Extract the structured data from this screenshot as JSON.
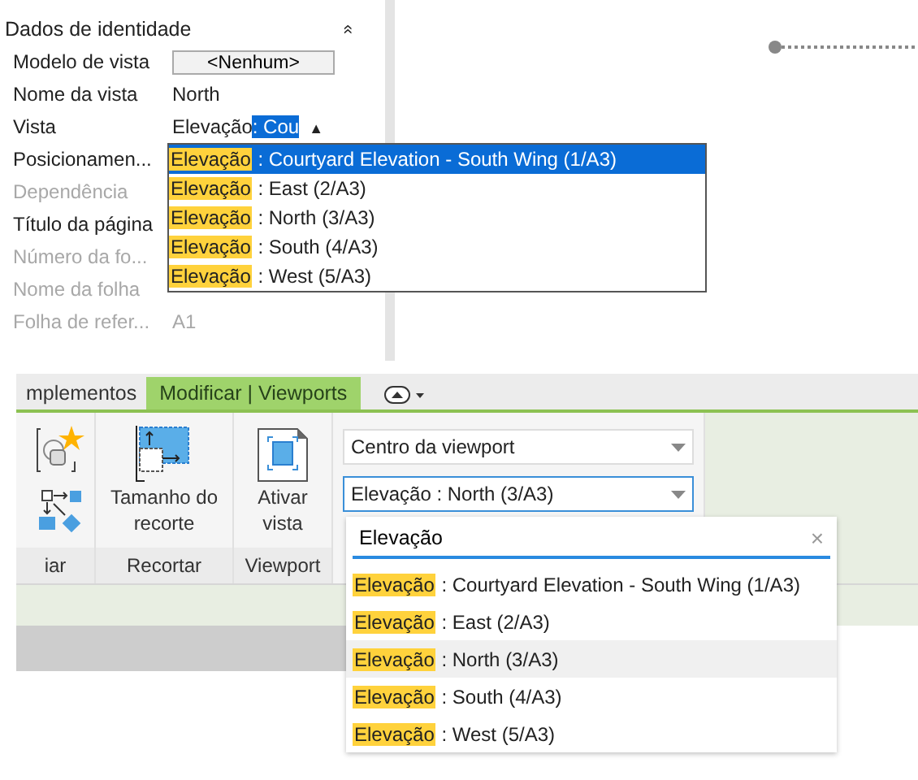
{
  "properties": {
    "header": "Dados de identidade",
    "collapse_icon": "»",
    "rows": [
      {
        "label": "Modelo de vista",
        "kind": "button",
        "value": "<Nenhum>",
        "disabled": false
      },
      {
        "label": "Nome da vista",
        "kind": "text",
        "value": "North",
        "disabled": false
      },
      {
        "label": "Vista",
        "kind": "combo",
        "value": "Elevação",
        "value_selected": ": Cou",
        "caret": "▲",
        "disabled": false
      },
      {
        "label": "Posicionamen...",
        "kind": "text",
        "disabled": false
      },
      {
        "label": "Dependência",
        "kind": "text",
        "disabled": true
      },
      {
        "label": "Título da página",
        "kind": "text",
        "disabled": false
      },
      {
        "label": "Número da fo...",
        "kind": "text",
        "disabled": true
      },
      {
        "label": "Nome da folha",
        "kind": "text",
        "disabled": true
      },
      {
        "label": "Folha de refer...",
        "kind": "text",
        "value": "A1",
        "disabled": true
      }
    ],
    "dropdown": [
      {
        "match": "Elevação",
        "rest": ": Courtyard Elevation - South Wing (1/A3)",
        "selected": true
      },
      {
        "match": "Elevação",
        "rest": ": East (2/A3)",
        "selected": false
      },
      {
        "match": "Elevação",
        "rest": ": North (3/A3)",
        "selected": false
      },
      {
        "match": "Elevação",
        "rest": ": South (4/A3)",
        "selected": false
      },
      {
        "match": "Elevação",
        "rest": ": West (5/A3)",
        "selected": false
      }
    ]
  },
  "ribbon": {
    "tabs": [
      {
        "label": "mplementos",
        "selected": false
      },
      {
        "label": "Modificar | Viewports",
        "selected": true
      }
    ],
    "panels": [
      {
        "label": "iar",
        "kind": "modify"
      },
      {
        "label": "Recortar",
        "kind": "crop",
        "button": "Tamanho do recorte"
      },
      {
        "label": "Viewport",
        "kind": "activate",
        "button": "Ativar vista"
      },
      {
        "kind": "combos",
        "combos": [
          {
            "value": "Centro da viewport",
            "focused": false
          },
          {
            "value": "Elevação : North (3/A3)",
            "focused": true
          }
        ]
      }
    ],
    "search": {
      "value": "Elevação",
      "clear": "×"
    },
    "results": [
      {
        "match": "Elevação",
        "rest": ": Courtyard Elevation - South Wing (1/A3)",
        "selected": false
      },
      {
        "match": "Elevação",
        "rest": ": East (2/A3)",
        "selected": false
      },
      {
        "match": "Elevação",
        "rest": ": North (3/A3)",
        "selected": true
      },
      {
        "match": "Elevação",
        "rest": ": South (4/A3)",
        "selected": false
      },
      {
        "match": "Elevação",
        "rest": ": West (5/A3)",
        "selected": false
      }
    ]
  }
}
